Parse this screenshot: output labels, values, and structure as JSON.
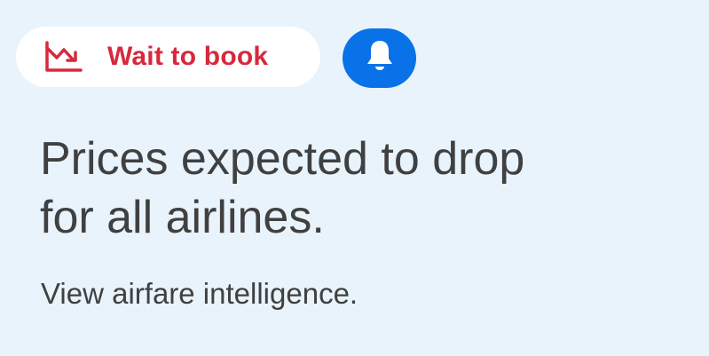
{
  "badge": {
    "label": "Wait to book",
    "icon": "trending-down-icon",
    "color": "#d6293e"
  },
  "alert_button": {
    "icon": "bell-icon",
    "color": "#0a72e8"
  },
  "headline": {
    "line1": "Prices expected to drop",
    "line2": "for all airlines."
  },
  "link": {
    "label": "View airfare intelligence."
  },
  "colors": {
    "background": "#e8f3fc",
    "text": "#404040"
  }
}
